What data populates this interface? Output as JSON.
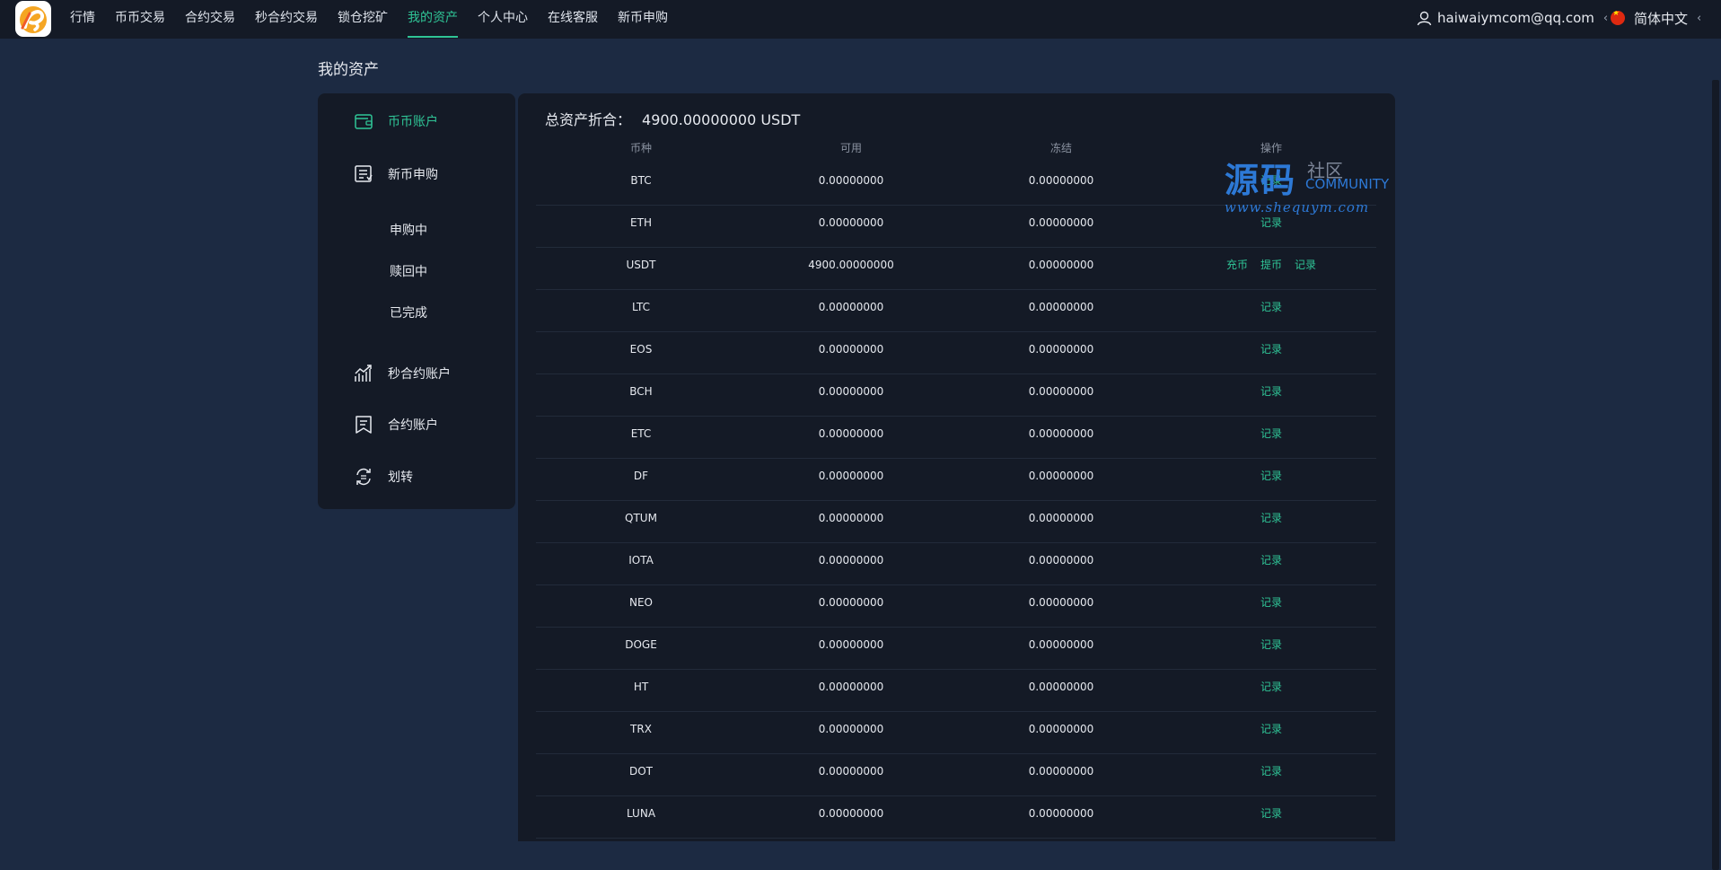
{
  "nav": {
    "items": [
      {
        "label": "行情",
        "active": false
      },
      {
        "label": "币币交易",
        "active": false
      },
      {
        "label": "合约交易",
        "active": false
      },
      {
        "label": "秒合约交易",
        "active": false
      },
      {
        "label": "锁仓挖矿",
        "active": false
      },
      {
        "label": "我的资产",
        "active": true
      },
      {
        "label": "个人中心",
        "active": false
      },
      {
        "label": "在线客服",
        "active": false
      },
      {
        "label": "新币申购",
        "active": false
      }
    ],
    "user_email": "haiwaiymcom@qq.com",
    "language": "简体中文"
  },
  "page": {
    "title": "我的资产"
  },
  "sidebar": {
    "items": [
      {
        "label": "币币账户",
        "icon": "wallet-icon",
        "active": true
      },
      {
        "label": "新币申购",
        "icon": "subscription-icon",
        "active": false
      },
      {
        "label": "秒合约账户",
        "icon": "chart-line-icon",
        "active": false
      },
      {
        "label": "合约账户",
        "icon": "document-icon",
        "active": false
      },
      {
        "label": "划转",
        "icon": "transfer-icon",
        "active": false
      }
    ],
    "subitems": [
      "申购中",
      "赎回中",
      "已完成"
    ]
  },
  "summary": {
    "label": "总资产折合：",
    "value": "4900.00000000 USDT"
  },
  "table": {
    "headers": [
      "币种",
      "可用",
      "冻结",
      "操作"
    ],
    "rows": [
      {
        "coin": "BTC",
        "available": "0.00000000",
        "frozen": "0.00000000",
        "actions": [
          "记录"
        ]
      },
      {
        "coin": "ETH",
        "available": "0.00000000",
        "frozen": "0.00000000",
        "actions": [
          "记录"
        ]
      },
      {
        "coin": "USDT",
        "available": "4900.00000000",
        "frozen": "0.00000000",
        "actions": [
          "充币",
          "提币",
          "记录"
        ]
      },
      {
        "coin": "LTC",
        "available": "0.00000000",
        "frozen": "0.00000000",
        "actions": [
          "记录"
        ]
      },
      {
        "coin": "EOS",
        "available": "0.00000000",
        "frozen": "0.00000000",
        "actions": [
          "记录"
        ]
      },
      {
        "coin": "BCH",
        "available": "0.00000000",
        "frozen": "0.00000000",
        "actions": [
          "记录"
        ]
      },
      {
        "coin": "ETC",
        "available": "0.00000000",
        "frozen": "0.00000000",
        "actions": [
          "记录"
        ]
      },
      {
        "coin": "DF",
        "available": "0.00000000",
        "frozen": "0.00000000",
        "actions": [
          "记录"
        ]
      },
      {
        "coin": "QTUM",
        "available": "0.00000000",
        "frozen": "0.00000000",
        "actions": [
          "记录"
        ]
      },
      {
        "coin": "IOTA",
        "available": "0.00000000",
        "frozen": "0.00000000",
        "actions": [
          "记录"
        ]
      },
      {
        "coin": "NEO",
        "available": "0.00000000",
        "frozen": "0.00000000",
        "actions": [
          "记录"
        ]
      },
      {
        "coin": "DOGE",
        "available": "0.00000000",
        "frozen": "0.00000000",
        "actions": [
          "记录"
        ]
      },
      {
        "coin": "HT",
        "available": "0.00000000",
        "frozen": "0.00000000",
        "actions": [
          "记录"
        ]
      },
      {
        "coin": "TRX",
        "available": "0.00000000",
        "frozen": "0.00000000",
        "actions": [
          "记录"
        ]
      },
      {
        "coin": "DOT",
        "available": "0.00000000",
        "frozen": "0.00000000",
        "actions": [
          "记录"
        ]
      },
      {
        "coin": "LUNA",
        "available": "0.00000000",
        "frozen": "0.00000000",
        "actions": [
          "记录"
        ]
      }
    ]
  },
  "watermark": {
    "big": "源码",
    "small": "社区",
    "en": "COMMUNITY",
    "url": "www.shequym.com"
  },
  "colors": {
    "accent": "#2fc496",
    "topbar": "#141a26",
    "page_bg": "#1c2a42",
    "panel": "#141a26"
  }
}
